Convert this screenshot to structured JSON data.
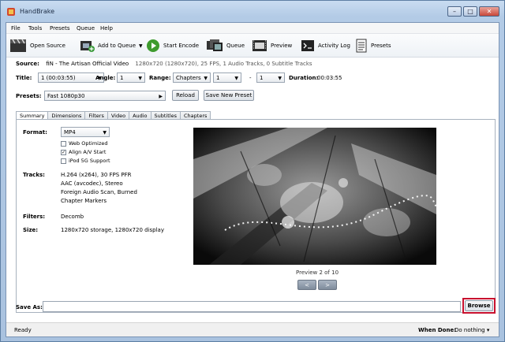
{
  "window": {
    "title": "HandBrake",
    "controls": {
      "minimize": "–",
      "maximize": "□",
      "close": "✕"
    }
  },
  "menu": [
    "File",
    "Tools",
    "Presets",
    "Queue",
    "Help"
  ],
  "toolbar": {
    "open_source": "Open Source",
    "add_to_queue": "Add to Queue",
    "start_encode": "Start Encode",
    "queue": "Queue",
    "preview": "Preview",
    "activity_log": "Activity Log",
    "presets": "Presets"
  },
  "source": {
    "label": "Source:",
    "name": "fiN - The Artisan Official Video",
    "info": "1280x720 (1280x720), 25 FPS, 1 Audio Tracks, 0 Subtitle Tracks"
  },
  "selection": {
    "title_label": "Title:",
    "title_value": "1 (00:03:55)",
    "angle_label": "Angle:",
    "angle_value": "1",
    "range_label": "Range:",
    "range_type": "Chapters",
    "range_start": "1",
    "range_sep": "-",
    "range_end": "1",
    "duration_label": "Duration:",
    "duration_value": "00:03:55"
  },
  "presets": {
    "label": "Presets:",
    "value": "Fast 1080p30",
    "reload": "Reload",
    "save_new": "Save New Preset"
  },
  "tabs": [
    "Summary",
    "Dimensions",
    "Filters",
    "Video",
    "Audio",
    "Subtitles",
    "Chapters"
  ],
  "summary": {
    "format_label": "Format:",
    "format_value": "MP4",
    "web_optimized": "Web Optimized",
    "align_av": "Align A/V Start",
    "ipod": "iPod 5G Support",
    "tracks_label": "Tracks:",
    "tracks": [
      "H.264 (x264), 30 FPS PFR",
      "AAC (avcodec), Stereo",
      "Foreign Audio Scan, Burned",
      "Chapter Markers"
    ],
    "filters_label": "Filters:",
    "filters_value": "Decomb",
    "size_label": "Size:",
    "size_value": "1280x720 storage, 1280x720 display"
  },
  "preview": {
    "caption": "Preview 2 of 10",
    "prev": "<",
    "next": ">"
  },
  "save_as": {
    "label": "Save As:",
    "value": "",
    "browse": "Browse"
  },
  "status": {
    "text": "Ready",
    "when_done_label": "When Done:",
    "when_done_value": "Do nothing"
  },
  "checks": {
    "web_optimized": false,
    "align_av": true,
    "ipod": false
  },
  "colors": {
    "highlight": "#c8102e",
    "title_bar": "#b3cbe6"
  }
}
